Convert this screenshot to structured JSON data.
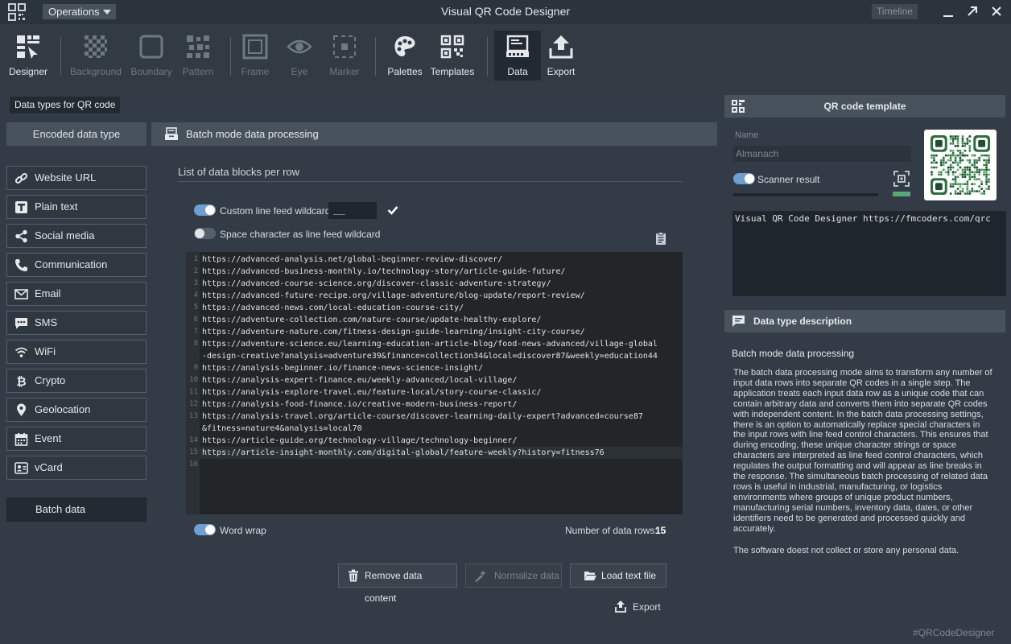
{
  "app": {
    "title": "Visual QR Code Designer",
    "operations_label": "Operations",
    "timeline_label": "Timeline"
  },
  "toolbar": [
    {
      "label": "Designer",
      "icon": "designer-icon",
      "enabled": true
    },
    {
      "label": "Background",
      "icon": "background-icon",
      "enabled": false
    },
    {
      "label": "Boundary",
      "icon": "boundary-icon",
      "enabled": false
    },
    {
      "label": "Pattern",
      "icon": "pattern-icon",
      "enabled": false
    },
    {
      "label": "Frame",
      "icon": "frame-icon",
      "enabled": false
    },
    {
      "label": "Eye",
      "icon": "eye-icon",
      "enabled": false
    },
    {
      "label": "Marker",
      "icon": "marker-icon",
      "enabled": false
    },
    {
      "label": "Palettes",
      "icon": "palette-icon",
      "enabled": true
    },
    {
      "label": "Templates",
      "icon": "templates-icon",
      "enabled": true
    },
    {
      "label": "Data",
      "icon": "data-icon",
      "enabled": true,
      "active": true
    },
    {
      "label": "Export",
      "icon": "export-icon",
      "enabled": true
    }
  ],
  "left": {
    "section_label": "Data types for QR code",
    "tab_label": "Encoded data type",
    "types": [
      {
        "label": "Website URL",
        "icon": "link-icon"
      },
      {
        "label": "Plain text",
        "icon": "text-icon"
      },
      {
        "label": "Social media",
        "icon": "share-icon"
      },
      {
        "label": "Communication",
        "icon": "phone-icon"
      },
      {
        "label": "Email",
        "icon": "envelope-icon"
      },
      {
        "label": "SMS",
        "icon": "chat-icon"
      },
      {
        "label": "WiFi",
        "icon": "wifi-icon"
      },
      {
        "label": "Crypto",
        "icon": "bitcoin-icon"
      },
      {
        "label": "Geolocation",
        "icon": "location-pin-icon"
      },
      {
        "label": "Event",
        "icon": "calendar-icon"
      },
      {
        "label": "vCard",
        "icon": "contact-card-icon"
      }
    ],
    "batch_label": "Batch data"
  },
  "center": {
    "header_label": "Batch mode data processing",
    "blocks_title": "List of data blocks per row",
    "custom_wildcards_label": "Custom line feed wildcards",
    "custom_wildcards_on": true,
    "wildcard_value": "__",
    "space_wildcard_label": "Space character as line feed wildcard",
    "space_wildcard_on": false,
    "lines": [
      {
        "n": "1",
        "text": "https://advanced-analysis.net/global-beginner-review-discover/"
      },
      {
        "n": "2",
        "text": "https://advanced-business-monthly.io/technology-story/article-guide-future/"
      },
      {
        "n": "3",
        "text": "https://advanced-course-science.org/discover-classic-adventure-strategy/"
      },
      {
        "n": "4",
        "text": "https://advanced-future-recipe.org/village-adventure/blog-update/report-review/"
      },
      {
        "n": "5",
        "text": "https://advanced-news.com/local-education-course-city/"
      },
      {
        "n": "6",
        "text": "https://adventure-collection.com/nature-course/update-healthy-explore/"
      },
      {
        "n": "7",
        "text": "https://adventure-nature.com/fitness-design-guide-learning/insight-city-course/"
      },
      {
        "n": "8",
        "text": "https://adventure-science.eu/learning-education-article-blog/food-news-advanced/village-global"
      },
      {
        "n": "",
        "text": "-design-creative?analysis=adventure39&finance=collection34&local=discover87&weekly=education44"
      },
      {
        "n": "9",
        "text": "https://analysis-beginner.io/finance-news-science-insight/"
      },
      {
        "n": "10",
        "text": "https://analysis-expert-finance.eu/weekly-advanced/local-village/"
      },
      {
        "n": "11",
        "text": "https://analysis-explore-travel.eu/feature-local/story-course-classic/"
      },
      {
        "n": "12",
        "text": "https://analysis-food-finance.io/creative-modern-business-report/"
      },
      {
        "n": "13",
        "text": "https://analysis-travel.org/article-course/discover-learning-daily-expert?advanced=course87"
      },
      {
        "n": "",
        "text": "&fitness=nature4&analysis=local70"
      },
      {
        "n": "14",
        "text": "https://article-guide.org/technology-village/technology-beginner/"
      },
      {
        "n": "15",
        "text": "https://article-insight-monthly.com/digital-global/feature-weekly?history=fitness76"
      },
      {
        "n": "16",
        "text": ""
      }
    ],
    "word_wrap_label": "Word wrap",
    "word_wrap_on": true,
    "rows_label": "Number of data rows:",
    "rows_count": "15",
    "remove_label": "Remove data content",
    "normalize_label": "Normalize data",
    "load_label": "Load text file",
    "export_label": "Export"
  },
  "right": {
    "template_header": "QR code template",
    "name_label": "Name",
    "name_value": "Almanach",
    "scanner_label": "Scanner result",
    "scanner_on": true,
    "content_text": "Visual QR Code Designer https://fmcoders.com/qrc",
    "desc_header": "Data type description",
    "desc_title": "Batch mode data processing",
    "desc_body": "The batch data processing mode aims to transform any number of input data rows into separate QR codes in a single step. The application treats each input data row as a unique code that can contain arbitrary data and converts them into separate QR codes with independent content. In the batch data processing settings, there is an option to automatically replace special characters in the input rows with line feed control characters. This ensures that during encoding, these unique character strings or space characters are interpreted as line feed control characters, which regulates the output formatting and will appear as line breaks in the response. The simultaneous batch processing of related data rows is useful in industrial, manufacturing, or logistics environments where groups of unique product numbers, manufacturing serial numbers, inventory data, dates, or other identifiers need to be generated and processed quickly and accurately.",
    "desc_privacy": "The software doest not collect or store any personal data.",
    "hashtag": "#QRCodeDesigner"
  },
  "colors": {
    "background": "#333c46",
    "titlebar": "#2b333c",
    "panel_header": "#48525d",
    "toggle_on": "#6f9ed0",
    "scanner_ok": "#5aa877"
  }
}
